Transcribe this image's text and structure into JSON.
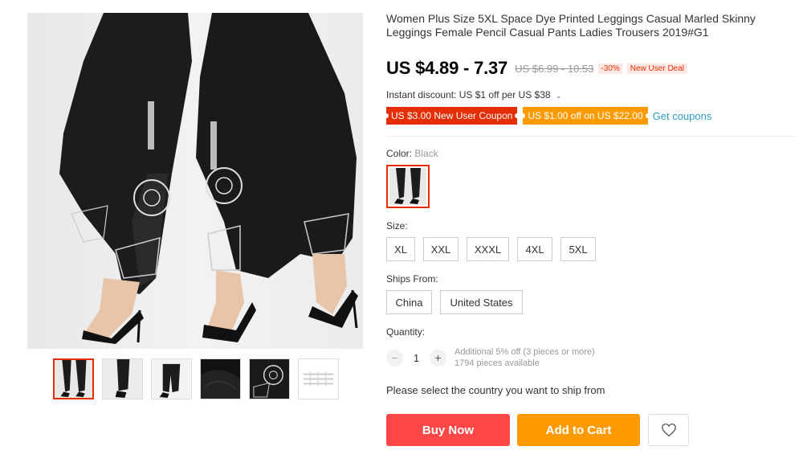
{
  "product": {
    "title": "Women Plus Size 5XL Space Dye Printed Leggings Casual Marled Skinny Leggings Female Pencil Casual Pants Ladies Trousers 2019#G1",
    "price": "US $4.89 - 7.37",
    "original_price": "US $6.99 - 10.53",
    "discount_badge": "-30%",
    "deal_badge": "New User Deal"
  },
  "instant_discount": {
    "text": "Instant discount: US $1 off per US $38",
    "chevron": "⌄"
  },
  "coupons": {
    "new_user": "US $3.00 New User Coupon",
    "off": "US $1.00 off on US $22.00",
    "get_link": "Get coupons"
  },
  "color": {
    "label": "Color:",
    "value": "Black"
  },
  "size": {
    "label": "Size:",
    "options": [
      "XL",
      "XXL",
      "XXXL",
      "4XL",
      "5XL"
    ]
  },
  "ships_from": {
    "label": "Ships From:",
    "options": [
      "China",
      "United States"
    ]
  },
  "quantity": {
    "label": "Quantity:",
    "value": "1",
    "minus": "−",
    "plus": "+",
    "note": "Additional 5% off (3 pieces or more)",
    "available": "1794 pieces available"
  },
  "ship_message": "Please select the country you want to ship from",
  "buttons": {
    "buy_now": "Buy Now",
    "add_to_cart": "Add to Cart",
    "wishlist_icon": "heart-icon"
  },
  "colors": {
    "accent_red": "#e62e04",
    "buy_red": "#ff4747",
    "cart_orange": "#ff9a00",
    "link_blue": "#2e9cc3"
  }
}
